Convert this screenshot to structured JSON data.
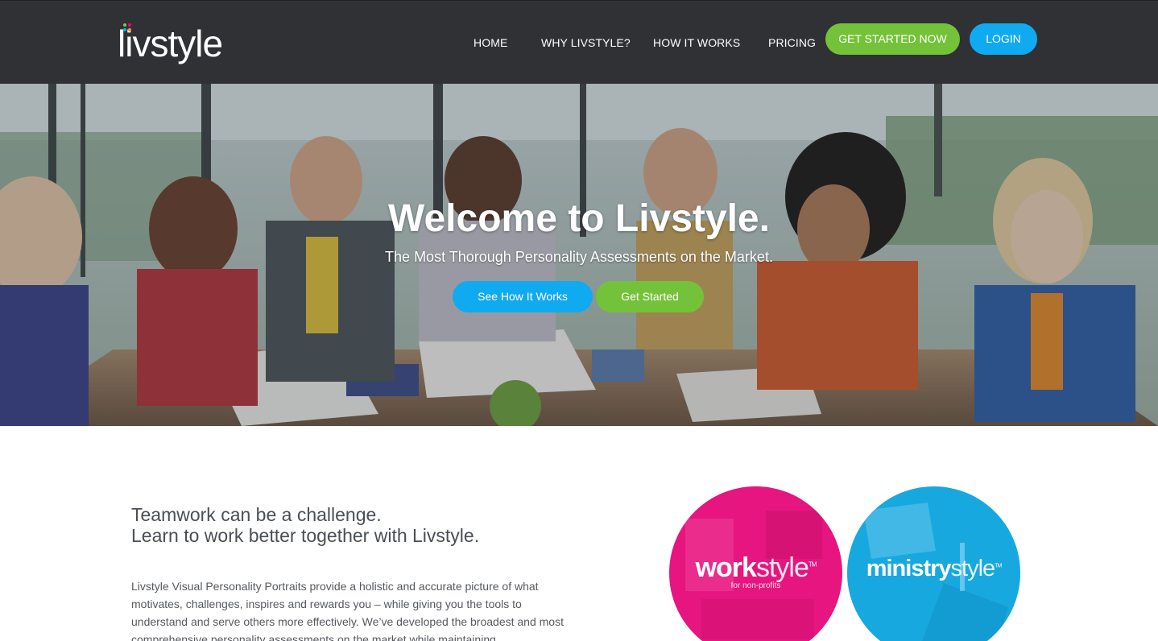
{
  "header": {
    "logo_text": "livstyle",
    "nav": [
      {
        "label": "HOME"
      },
      {
        "label": "WHY LIVSTYLE?"
      },
      {
        "label": "HOW IT WORKS"
      },
      {
        "label": "PRICING"
      }
    ],
    "cta_label": "GET STARTED NOW",
    "login_label": "LOGIN"
  },
  "hero": {
    "title": "Welcome to Livstyle.",
    "subtitle": "The Most Thorough Personality Assessments on the Market.",
    "see_how_label": "See How It Works",
    "get_started_label": "Get Started"
  },
  "content": {
    "heading_line1": "Teamwork can be a challenge.",
    "heading_line2": "Learn to work better together with Livstyle.",
    "body": "Livstyle Visual Personality Portraits provide a holistic and accurate picture of what motivates, challenges, inspires and rewards you – while giving you the tools to understand and serve others more effectively. We’ve developed the broadest and most comprehensive personality assessments on the market while maintaining"
  },
  "products": [
    {
      "name_bold": "work",
      "name_light": "style",
      "trademark": "TM",
      "tagline": "for non-profits"
    },
    {
      "name_bold": "ministry",
      "name_light": "style",
      "trademark": "TM"
    }
  ],
  "colors": {
    "nav_bg": "#2f3134",
    "green": "#74c23a",
    "blue": "#10aaf0",
    "pink": "#e6157f",
    "cyan": "#17a8e0",
    "text": "#4a4f55"
  },
  "icons": {
    "logo_dots": [
      "#8dc63f",
      "#ec008c",
      "#00aeef",
      "#f7941d"
    ]
  }
}
